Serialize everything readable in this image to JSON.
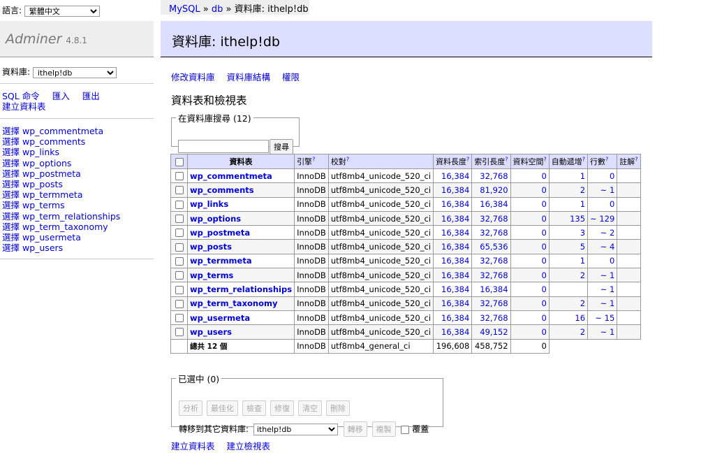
{
  "lang": {
    "label": "語言:",
    "selected": "繁體中文"
  },
  "brand": {
    "name": "Adminer",
    "version": "4.8.1"
  },
  "db_select": {
    "label": "資料庫:",
    "selected": "ithelp!db"
  },
  "menu_links": {
    "sql": "SQL 命令",
    "import": "匯入",
    "export": "匯出",
    "create_table": "建立資料表"
  },
  "table_links": [
    "選擇 wp_commentmeta",
    "選擇 wp_comments",
    "選擇 wp_links",
    "選擇 wp_options",
    "選擇 wp_postmeta",
    "選擇 wp_posts",
    "選擇 wp_termmeta",
    "選擇 wp_terms",
    "選擇 wp_term_relationships",
    "選擇 wp_term_taxonomy",
    "選擇 wp_usermeta",
    "選擇 wp_users"
  ],
  "breadcrumb": {
    "mysql": "MySQL",
    "sep1": " » ",
    "db": "db",
    "sep2": " » ",
    "current": "資料庫: ithelp!db"
  },
  "title": "資料庫: ithelp!db",
  "nav": {
    "alter": "修改資料庫",
    "schema": "資料庫結構",
    "privileges": "權限"
  },
  "section_title": "資料表和檢視表",
  "search": {
    "legend": "在資料庫搜尋 (12)",
    "value": "",
    "button": "搜尋"
  },
  "table": {
    "headers": {
      "name": "資料表",
      "engine": "引擎",
      "collation": "校對",
      "data_length": "資料長度",
      "index_length": "索引長度",
      "data_free": "資料空間",
      "auto_increment": "自動遞增",
      "rows": "行數",
      "comment": "註解",
      "help": "?"
    },
    "rows": [
      [
        "wp_commentmeta",
        "InnoDB",
        "utf8mb4_unicode_520_ci",
        "16,384",
        "32,768",
        "0",
        "1",
        "0"
      ],
      [
        "wp_comments",
        "InnoDB",
        "utf8mb4_unicode_520_ci",
        "16,384",
        "81,920",
        "0",
        "2",
        "~ 1"
      ],
      [
        "wp_links",
        "InnoDB",
        "utf8mb4_unicode_520_ci",
        "16,384",
        "16,384",
        "0",
        "1",
        "0"
      ],
      [
        "wp_options",
        "InnoDB",
        "utf8mb4_unicode_520_ci",
        "16,384",
        "32,768",
        "0",
        "135",
        "~ 129"
      ],
      [
        "wp_postmeta",
        "InnoDB",
        "utf8mb4_unicode_520_ci",
        "16,384",
        "32,768",
        "0",
        "3",
        "~ 2"
      ],
      [
        "wp_posts",
        "InnoDB",
        "utf8mb4_unicode_520_ci",
        "16,384",
        "65,536",
        "0",
        "5",
        "~ 4"
      ],
      [
        "wp_termmeta",
        "InnoDB",
        "utf8mb4_unicode_520_ci",
        "16,384",
        "32,768",
        "0",
        "1",
        "0"
      ],
      [
        "wp_terms",
        "InnoDB",
        "utf8mb4_unicode_520_ci",
        "16,384",
        "32,768",
        "0",
        "2",
        "~ 1"
      ],
      [
        "wp_term_relationships",
        "InnoDB",
        "utf8mb4_unicode_520_ci",
        "16,384",
        "16,384",
        "0",
        "",
        "~ 1"
      ],
      [
        "wp_term_taxonomy",
        "InnoDB",
        "utf8mb4_unicode_520_ci",
        "16,384",
        "32,768",
        "0",
        "2",
        "~ 1"
      ],
      [
        "wp_usermeta",
        "InnoDB",
        "utf8mb4_unicode_520_ci",
        "16,384",
        "32,768",
        "0",
        "16",
        "~ 15"
      ],
      [
        "wp_users",
        "InnoDB",
        "utf8mb4_unicode_520_ci",
        "16,384",
        "49,152",
        "0",
        "2",
        "~ 1"
      ]
    ],
    "total": {
      "label": "總共 12 個",
      "engine": "InnoDB",
      "collation": "utf8mb4_general_ci",
      "data_length": "196,608",
      "index_length": "458,752",
      "data_free": "0"
    }
  },
  "selected": {
    "legend": "已選中 (0)",
    "buttons": [
      "分析",
      "最佳化",
      "檢查",
      "修復",
      "清空",
      "刪除"
    ],
    "move_label": "轉移到其它資料庫:",
    "move_target": "ithelp!db",
    "move_button": "轉移",
    "copy_button": "複製",
    "overwrite": "覆蓋"
  },
  "bottom": {
    "create_table": "建立資料表",
    "create_view": "建立檢視表"
  }
}
